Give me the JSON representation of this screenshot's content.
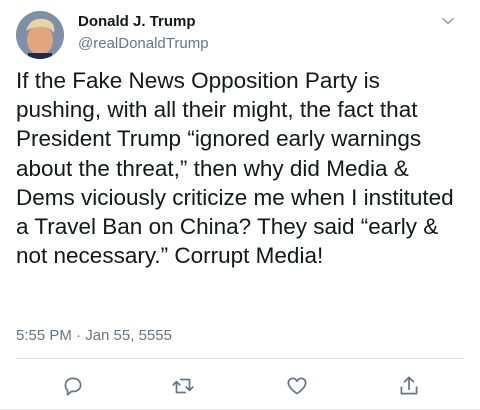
{
  "author": {
    "name": "Donald J. Trump",
    "handle": "@realDonaldTrump"
  },
  "tweet": {
    "text": "If the Fake News Opposition Party is pushing, with all their might, the fact that President Trump “ignored early warnings about the threat,” then why did Media & Dems viciously criticize me when I instituted a Travel Ban on China? They said “early & not necessary.” Corrupt Media!",
    "timestamp": "5:55 PM · Jan 55, 5555"
  },
  "icons": {
    "menu": "chevron-down-icon",
    "reply": "reply-icon",
    "retweet": "retweet-icon",
    "like": "like-icon",
    "share": "share-icon"
  },
  "colors": {
    "text": "#14171a",
    "secondary": "#657786",
    "divider": "#e1e8ed"
  }
}
